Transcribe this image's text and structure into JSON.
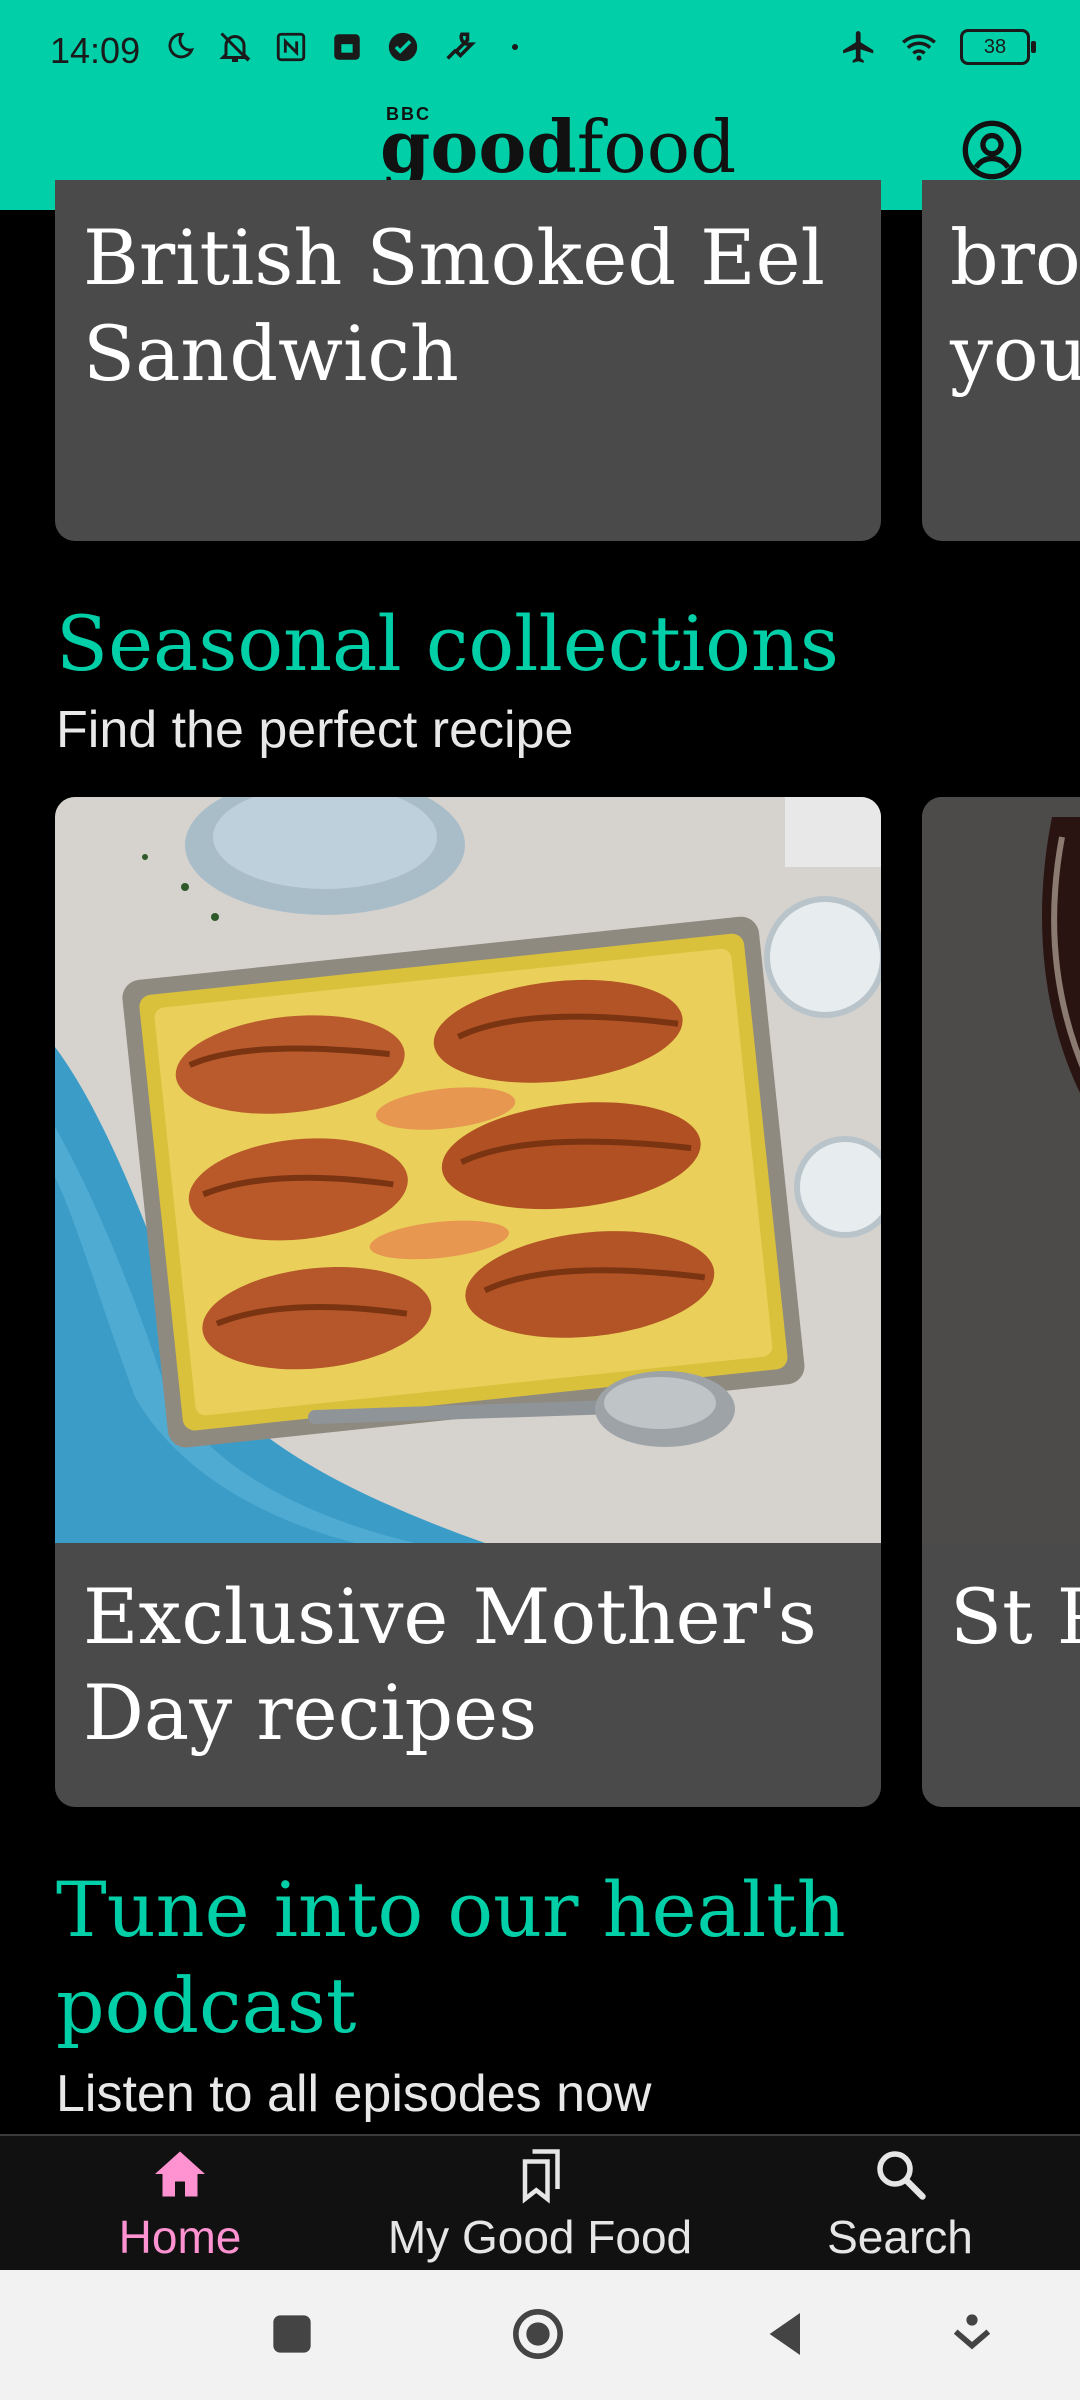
{
  "status_bar": {
    "time": "14:09",
    "battery": "38"
  },
  "header": {
    "logo_bbc": "BBC",
    "logo_good": "good",
    "logo_food": "food",
    "account_icon": "account-circle-icon"
  },
  "top_row": {
    "card_title": "British Smoked Eel\nSandwich",
    "peek_title": "bro\nyou"
  },
  "seasonal": {
    "title": "Seasonal collections",
    "subtitle": "Find the perfect recipe",
    "card_title": "Exclusive Mother's\nDay recipes",
    "peek_title": "St P"
  },
  "podcast": {
    "title_line1": "Tune into our health",
    "title_line2": "podcast",
    "subtitle": "Listen to all episodes now"
  },
  "bottom_nav": {
    "items": [
      {
        "label": "Home",
        "icon": "home-icon",
        "active": true
      },
      {
        "label": "My Good Food",
        "icon": "bookmarks-icon",
        "active": false
      },
      {
        "label": "Search",
        "icon": "search-icon",
        "active": false
      }
    ]
  },
  "colors": {
    "brand": "#00cfa8",
    "active_nav": "#ff92d0",
    "card": "#4a4a4a"
  }
}
